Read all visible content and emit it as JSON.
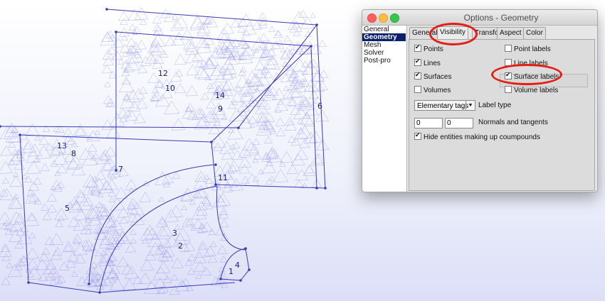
{
  "viewport": {
    "entity_labels": [
      "12",
      "10",
      "14",
      "9",
      "6",
      "13",
      "8",
      "7",
      "11",
      "5",
      "3",
      "2",
      "4",
      "1"
    ]
  },
  "dialog": {
    "title": "Options - Geometry",
    "sidebar": [
      "General",
      "Geometry",
      "Mesh",
      "Solver",
      "Post-pro"
    ],
    "tabs": [
      "General",
      "Visibility",
      "Transfo",
      "Aspect",
      "Color"
    ],
    "checkboxes": {
      "points": {
        "label": "Points",
        "checked": true
      },
      "point_labels": {
        "label": "Point labels",
        "checked": false
      },
      "lines": {
        "label": "Lines",
        "checked": true
      },
      "line_labels": {
        "label": "Line labels",
        "checked": false
      },
      "surfaces": {
        "label": "Surfaces",
        "checked": true
      },
      "surface_labels": {
        "label": "Surface labels",
        "checked": true
      },
      "volumes": {
        "label": "Volumes",
        "checked": false
      },
      "volume_labels": {
        "label": "Volume labels",
        "checked": false
      },
      "hide_compounds": {
        "label": "Hide entities making up coumpounds",
        "checked": true
      }
    },
    "label_type_select": "Elementary tags",
    "label_type_label": "Label type",
    "normals_value": "0",
    "tangents_value": "0",
    "normals_label": "Normals and tangents"
  },
  "colors": {
    "mesh": "#5a5ae0",
    "highlight": "#e41e14",
    "selected": "#0b1f6e"
  }
}
